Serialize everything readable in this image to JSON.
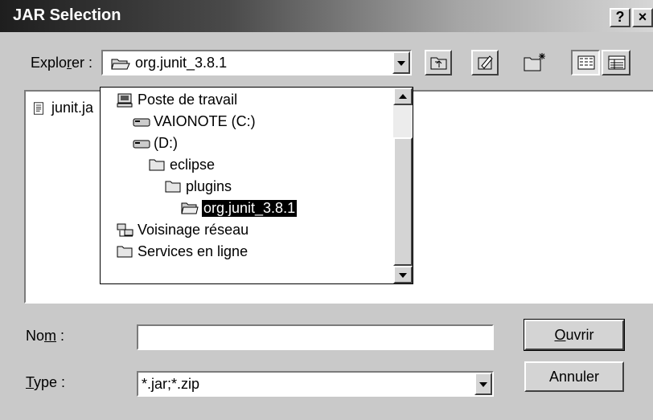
{
  "window": {
    "title": "JAR Selection",
    "help_glyph": "?",
    "close_glyph": "×"
  },
  "lookin": {
    "label_pre": "Explo",
    "label_key": "r",
    "label_post": "er :",
    "value": "org.junit_3.8.1"
  },
  "toolbar": {
    "icons": [
      "folder-up-icon",
      "new-folder-icon",
      "create-folder-icon",
      "list-view-icon",
      "details-view-icon"
    ]
  },
  "filelist": {
    "items": [
      {
        "name": "junit.ja"
      }
    ]
  },
  "dropdown": {
    "items": [
      {
        "label": "Poste de travail",
        "icon": "computer-icon"
      },
      {
        "label": "VAIONOTE (C:)",
        "icon": "drive-icon"
      },
      {
        "label": "(D:)",
        "icon": "drive-icon"
      },
      {
        "label": "eclipse",
        "icon": "folder-icon"
      },
      {
        "label": "plugins",
        "icon": "folder-icon"
      },
      {
        "label": "org.junit_3.8.1",
        "icon": "open-folder-icon",
        "selected": true
      },
      {
        "label": "Voisinage réseau",
        "icon": "network-icon"
      },
      {
        "label": "Services en ligne",
        "icon": "folder-icon"
      }
    ]
  },
  "name_field": {
    "label_pre": "No",
    "label_key": "m",
    "label_post": " :",
    "value": ""
  },
  "type_field": {
    "label_key": "T",
    "label_post": "ype :",
    "value": "*.jar;*.zip"
  },
  "buttons": {
    "open_key": "O",
    "open_rest": "uvrir",
    "cancel": "Annuler"
  }
}
